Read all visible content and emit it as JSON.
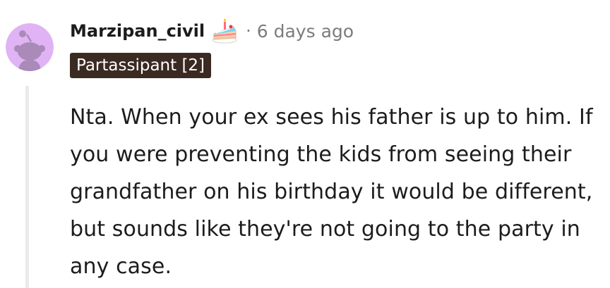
{
  "comment": {
    "username": "Marzipan_civil",
    "separator": "·",
    "timestamp": "6 days ago",
    "flair": "Partassipant [2]",
    "body": "Nta. When your ex sees his father is up to him. If you were preventing the kids from seeing their grandfather on his birthday it would be different, but sounds like they're not going to the party in any case.",
    "avatar_icon": "snoo-avatar-icon",
    "cake_icon": "cake-day-icon"
  },
  "colors": {
    "avatar_bg": "#e0b3f4",
    "flair_bg": "#3b2a22",
    "muted_text": "#7c7c7c",
    "thread_line": "#eaeaea"
  }
}
